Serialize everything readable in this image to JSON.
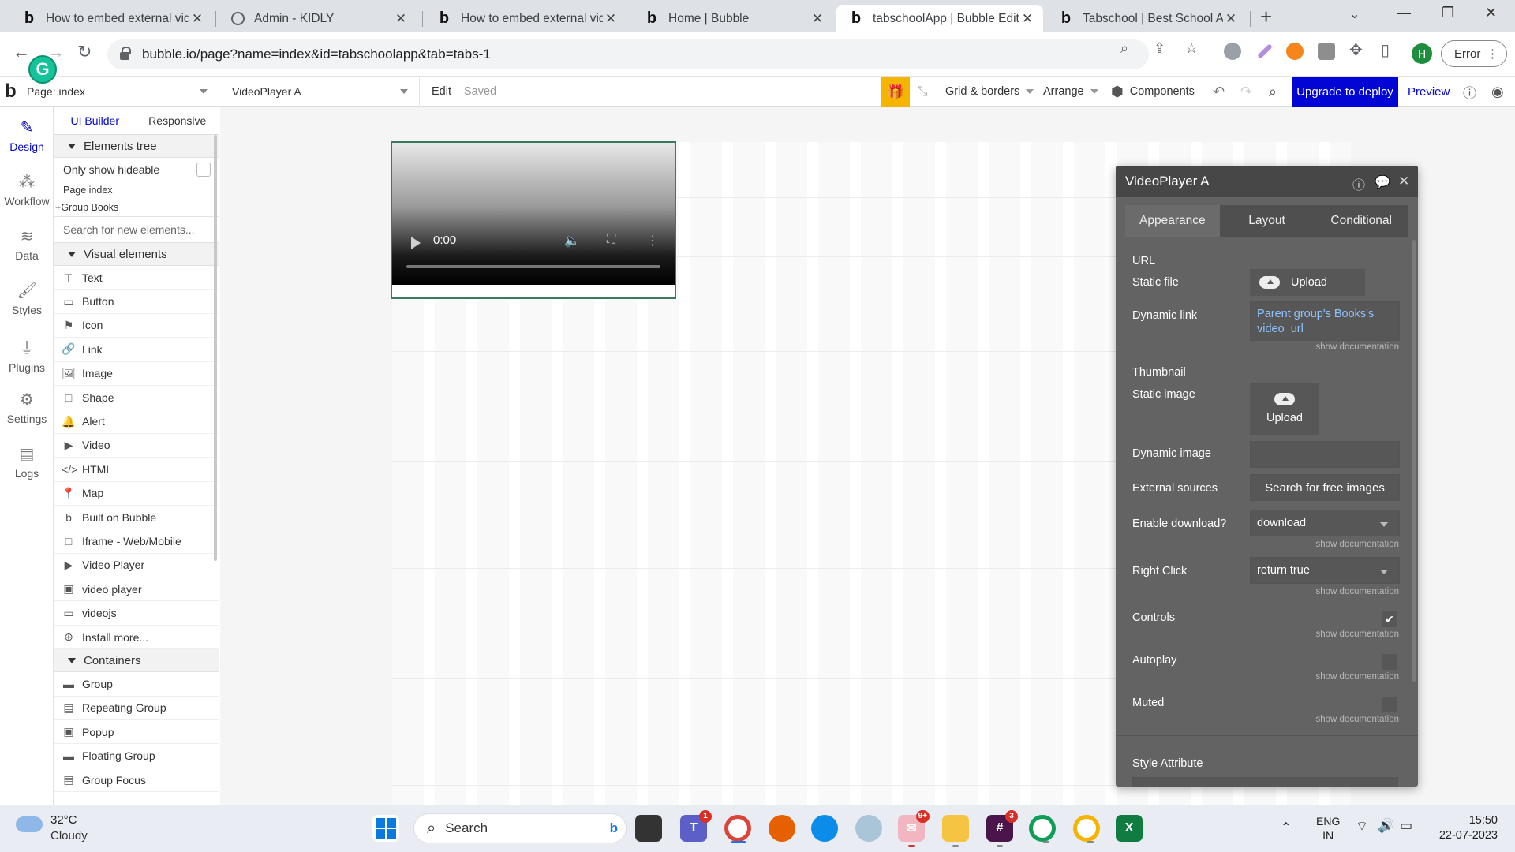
{
  "browser": {
    "tabs": [
      {
        "title": "How to embed external vid",
        "favicon": "bubble-b"
      },
      {
        "title": "Admin - KIDLY",
        "favicon": "globe-icon"
      },
      {
        "title": "How to embed external vid",
        "favicon": "bubble-b"
      },
      {
        "title": "Home | Bubble",
        "favicon": "bubble-b"
      },
      {
        "title": "tabschoolApp | Bubble Edit",
        "favicon": "bubble-b",
        "active": true
      },
      {
        "title": "Tabschool | Best School Au",
        "favicon": "bubble-b"
      }
    ],
    "url": "bubble.io/page?name=index&id=tabschoolapp&tab=tabs-1",
    "profile_initial": "H",
    "error_label": "Error",
    "grammarly_letter": "G"
  },
  "editor_header": {
    "logo": "b",
    "page_select": "Page: index",
    "element_select": "VideoPlayer A",
    "edit_label": "Edit",
    "saved_label": "Saved",
    "grid_borders": "Grid & borders",
    "arrange": "Arrange",
    "components": "Components",
    "upgrade": "Upgrade to deploy",
    "preview": "Preview"
  },
  "rail": [
    {
      "label": "Design",
      "icon": "design-icon"
    },
    {
      "label": "Workflow",
      "icon": "workflow-icon"
    },
    {
      "label": "Data",
      "icon": "data-icon"
    },
    {
      "label": "Styles",
      "icon": "styles-icon"
    },
    {
      "label": "Plugins",
      "icon": "plugins-icon"
    },
    {
      "label": "Settings",
      "icon": "settings-icon"
    },
    {
      "label": "Logs",
      "icon": "logs-icon"
    }
  ],
  "panel": {
    "tabs": [
      "UI Builder",
      "Responsive"
    ],
    "elements_tree": "Elements tree",
    "only_show_hideable": "Only show hideable",
    "tree": [
      "Page index",
      "Group Books"
    ],
    "search_placeholder": "Search for new elements...",
    "visual_elements": "Visual elements",
    "visual_items": [
      {
        "label": "Text",
        "icon": "T"
      },
      {
        "label": "Button",
        "icon": "▭"
      },
      {
        "label": "Icon",
        "icon": "⚑"
      },
      {
        "label": "Link",
        "icon": "🔗"
      },
      {
        "label": "Image",
        "icon": "🖼"
      },
      {
        "label": "Shape",
        "icon": "□"
      },
      {
        "label": "Alert",
        "icon": "🔔"
      },
      {
        "label": "Video",
        "icon": "▶"
      },
      {
        "label": "HTML",
        "icon": "</>"
      },
      {
        "label": "Map",
        "icon": "📍"
      },
      {
        "label": "Built on Bubble",
        "icon": "b"
      },
      {
        "label": "Iframe - Web/Mobile",
        "icon": "□"
      },
      {
        "label": "Video Player",
        "icon": "▶"
      },
      {
        "label": "video player",
        "icon": "▣"
      },
      {
        "label": "videojs",
        "icon": "▭"
      },
      {
        "label": "Install more...",
        "icon": "⊕"
      }
    ],
    "containers": "Containers",
    "container_items": [
      {
        "label": "Group",
        "icon": "▬"
      },
      {
        "label": "Repeating Group",
        "icon": "▤"
      },
      {
        "label": "Popup",
        "icon": "▣"
      },
      {
        "label": "Floating Group",
        "icon": "▬"
      },
      {
        "label": "Group Focus",
        "icon": "▤"
      }
    ]
  },
  "video_player": {
    "time": "0:00"
  },
  "props": {
    "title": "VideoPlayer A",
    "tabs": [
      "Appearance",
      "Layout",
      "Conditional"
    ],
    "url_label": "URL",
    "static_file": "Static file",
    "upload": "Upload",
    "dynamic_link": "Dynamic link",
    "dynamic_link_value": "Parent group's Books's video_url",
    "show_doc": "show documentation",
    "thumbnail": "Thumbnail",
    "static_image": "Static image",
    "dynamic_image": "Dynamic image",
    "external_sources": "External sources",
    "search_free_images": "Search for free images",
    "enable_download": "Enable download?",
    "enable_download_value": "download",
    "right_click": "Right Click",
    "right_click_value": "return true",
    "controls": "Controls",
    "controls_checked": true,
    "autoplay": "Autoplay",
    "muted": "Muted",
    "style_attribute": "Style Attribute"
  },
  "taskbar": {
    "temp": "32°C",
    "weather": "Cloudy",
    "search": "Search",
    "lang1": "ENG",
    "lang2": "IN",
    "time": "15:50",
    "date": "22-07-2023",
    "badges": {
      "teams": "1",
      "mail": "9+",
      "slack": "3"
    }
  },
  "colors": {
    "bubble_blue": "#0205d3",
    "props_bg": "#636364",
    "gift": "#f4b400"
  }
}
